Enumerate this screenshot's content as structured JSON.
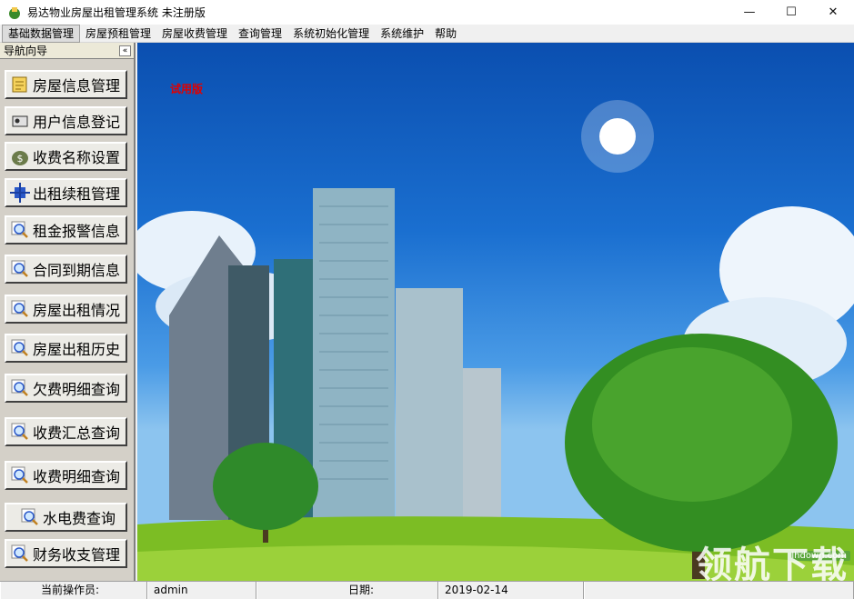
{
  "window": {
    "title": "易达物业房屋出租管理系统 未注册版",
    "minimize": "—",
    "maximize": "☐",
    "close": "✕"
  },
  "menu": [
    {
      "label": "基础数据管理",
      "active": true
    },
    {
      "label": "房屋预租管理"
    },
    {
      "label": "房屋收费管理"
    },
    {
      "label": "查询管理"
    },
    {
      "label": "系统初始化管理"
    },
    {
      "label": "系统维护"
    },
    {
      "label": "帮助"
    }
  ],
  "nav": {
    "title": "导航向导",
    "collapse": "«",
    "items": [
      {
        "label": "房屋信息管理",
        "icon": "house-doc-icon"
      },
      {
        "label": "用户信息登记",
        "icon": "user-card-icon"
      },
      {
        "label": "收费名称设置",
        "icon": "money-bag-icon"
      },
      {
        "label": "出租续租管理",
        "icon": "rent-arrows-icon"
      },
      {
        "label": "租金报警信息",
        "icon": "magnifier-icon"
      },
      {
        "label": "合同到期信息",
        "icon": "magnifier-icon"
      },
      {
        "label": "房屋出租情况",
        "icon": "magnifier-icon"
      },
      {
        "label": "房屋出租历史",
        "icon": "magnifier-icon"
      },
      {
        "label": "欠费明细查询",
        "icon": "magnifier-icon"
      },
      {
        "label": "收费汇总查询",
        "icon": "magnifier-icon"
      },
      {
        "label": "收费明细查询",
        "icon": "magnifier-icon"
      },
      {
        "label": "水电费查询",
        "icon": "magnifier-icon"
      },
      {
        "label": "财务收支管理",
        "icon": "magnifier-icon"
      }
    ]
  },
  "main": {
    "trial_text": "试用版",
    "watermark_site": "lhdown.com",
    "watermark_text": "领航下载"
  },
  "status": {
    "operator_label": "当前操作员:",
    "operator_value": "admin",
    "date_label": "日期:",
    "date_value": "2019-02-14"
  }
}
